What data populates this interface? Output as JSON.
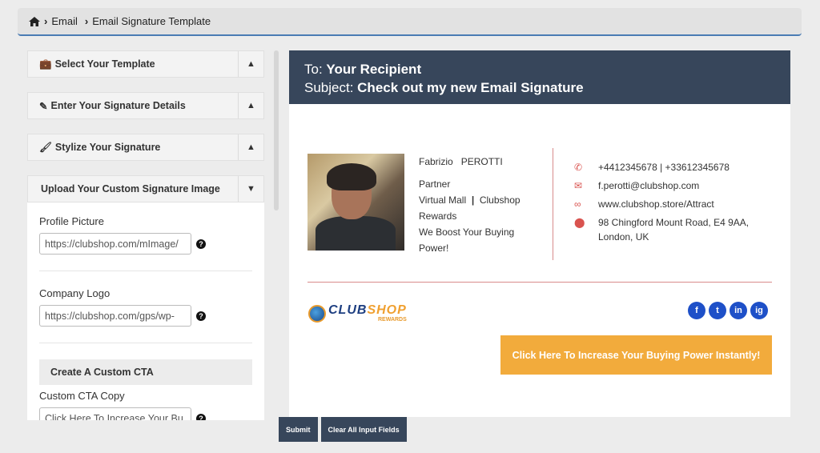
{
  "breadcrumb": {
    "items": [
      "Email",
      "Email Signature Template"
    ]
  },
  "sections": [
    {
      "title": "Select Your Template"
    },
    {
      "title": "Enter Your Signature Details"
    },
    {
      "title": "Stylize Your Signature"
    }
  ],
  "upload": {
    "title": "Upload Your Custom Signature Image",
    "profile_label": "Profile Picture",
    "profile_value": "https://clubshop.com/mImage/",
    "logo_label": "Company Logo",
    "logo_value": "https://clubshop.com/gps/wp-",
    "cta_section": "Create A Custom CTA",
    "cta_copy_label": "Custom CTA Copy",
    "cta_copy_value": "Click Here To Increase Your Bu"
  },
  "preview": {
    "to_label": "To: ",
    "to_value": "Your Recipient",
    "subject_label": "Subject: ",
    "subject_value": "Check out my new Email Signature",
    "first_name": "Fabrizio",
    "last_name": "PEROTTI",
    "role": "Partner",
    "company_a": "Virtual Mall",
    "company_sep": "|",
    "company_b": "Clubshop",
    "company_c": "Rewards",
    "tagline": "We Boost Your Buying Power!",
    "phone": "+4412345678 | +33612345678",
    "email": "f.perotti@clubshop.com",
    "website": "www.clubshop.store/Attract",
    "address": "98 Chingford Mount Road, E4 9AA, London, UK",
    "logo_club": "CLUB",
    "logo_shop": "SHOP",
    "logo_rewards": "REWARDS",
    "social": [
      "f",
      "t",
      "in",
      "ig"
    ],
    "cta": "Click Here To Increase Your Buying Power Instantly!"
  },
  "actions": {
    "submit": "Submit",
    "clear": "Clear All Input Fields"
  },
  "colors": {
    "header": "#37465b",
    "accent": "#f2ab3c",
    "divider": "#d88b8b",
    "social": "#1e50c8"
  }
}
